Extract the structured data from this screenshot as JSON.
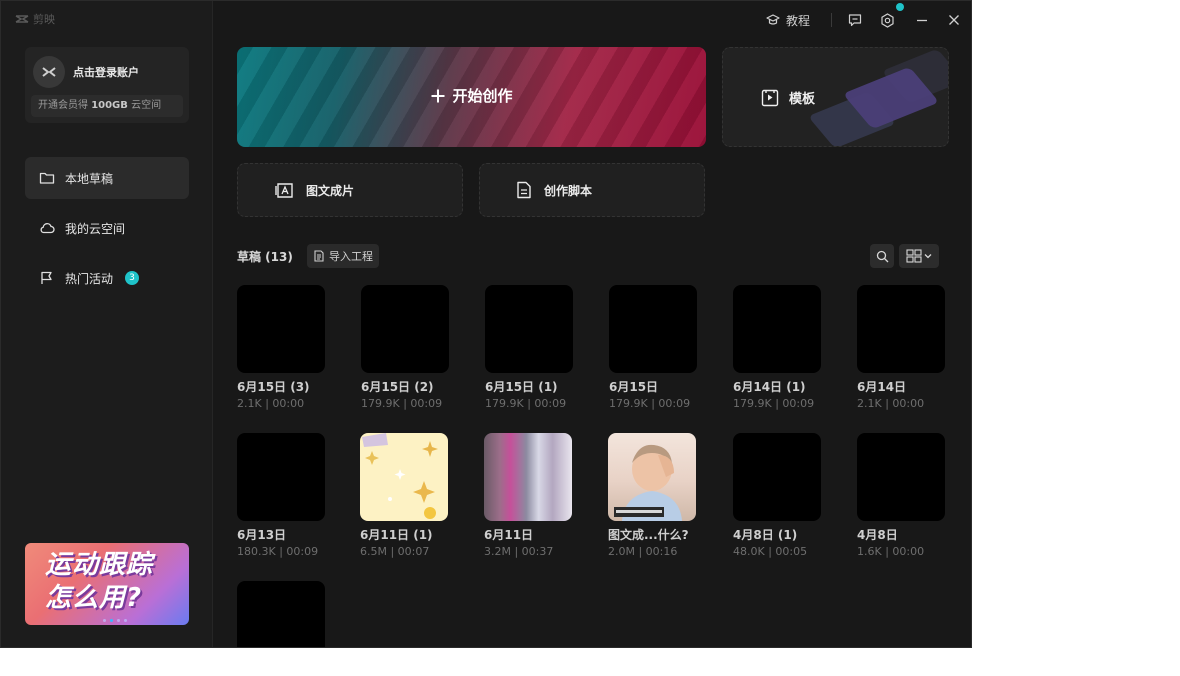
{
  "app": {
    "logo": "剪映"
  },
  "titlebar": {
    "tutorial_label": "教程"
  },
  "account": {
    "avatar_mark": "CC",
    "login_label": "点击登录账户",
    "member_prefix": "开通会员得",
    "member_highlight": "100GB",
    "member_suffix": "云空间"
  },
  "sidebar": {
    "items": [
      {
        "label": "本地草稿",
        "active": true
      },
      {
        "label": "我的云空间",
        "active": false
      },
      {
        "label": "热门活动",
        "active": false,
        "badge": "3"
      }
    ]
  },
  "promo": {
    "line1": "运动跟踪",
    "line2": "怎么用?"
  },
  "main": {
    "create_label": "开始创作",
    "template_label": "模板",
    "image_to_video_label": "图文成片",
    "script_label": "创作脚本",
    "drafts_title": "草稿 (13)",
    "import_label": "导入工程"
  },
  "drafts": [
    {
      "name": "6月15日 (3)",
      "meta": "2.1K | 00:00",
      "thumb": "black"
    },
    {
      "name": "6月15日 (2)",
      "meta": "179.9K | 00:09",
      "thumb": "black"
    },
    {
      "name": "6月15日 (1)",
      "meta": "179.9K | 00:09",
      "thumb": "black"
    },
    {
      "name": "6月15日",
      "meta": "179.9K | 00:09",
      "thumb": "black"
    },
    {
      "name": "6月14日 (1)",
      "meta": "179.9K | 00:09",
      "thumb": "black"
    },
    {
      "name": "6月14日",
      "meta": "2.1K | 00:00",
      "thumb": "black"
    },
    {
      "name": "6月13日",
      "meta": "180.3K | 00:09",
      "thumb": "black"
    },
    {
      "name": "6月11日 (1)",
      "meta": "6.5M | 00:07",
      "thumb": "stars"
    },
    {
      "name": "6月11日",
      "meta": "3.2M | 00:37",
      "thumb": "blur"
    },
    {
      "name": "图文成...什么?",
      "meta": "2.0M | 00:16",
      "thumb": "child"
    },
    {
      "name": "4月8日 (1)",
      "meta": "48.0K | 00:05",
      "thumb": "black"
    },
    {
      "name": "4月8日",
      "meta": "1.6K | 00:00",
      "thumb": "black"
    },
    {
      "name": "",
      "meta": "",
      "thumb": "black"
    }
  ],
  "colors": {
    "accent": "#1fc3c9",
    "background": "#181818",
    "sidebar": "#1c1c1c"
  }
}
